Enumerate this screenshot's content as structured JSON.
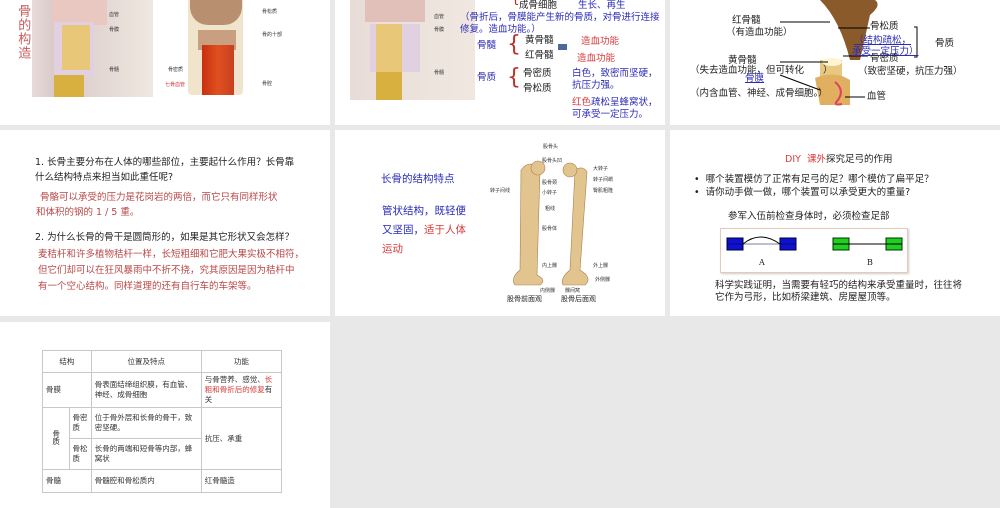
{
  "slides": {
    "s1": {
      "title": "骨的构造",
      "img1_labels": [
        "血管",
        "骨膜",
        "骨髓"
      ],
      "img2_labels": [
        "骨松质",
        "骨的十部",
        "骨密质",
        "七骨血管",
        "骨腔"
      ]
    },
    "s2": {
      "img_labels": [
        "血管",
        "骨膜",
        "骨髓"
      ],
      "osteoblast": "成骨细胞",
      "osteoblast_fn": "生长、再生",
      "note1": "（骨折后，骨膜能产生新的骨质，对骨进行连接",
      "note2": "修复。造血功能。）",
      "marrow": "骨髓",
      "yellow_marrow": "黄骨髓",
      "red_marrow": "红骨髓",
      "fn1": "造血功能",
      "fn2": "造血功能",
      "bone_substance": "骨质",
      "compact": "骨密质",
      "spongy": "骨松质",
      "compact_desc1": "白色，致密而坚硬，",
      "compact_desc2": "抗压力强。",
      "spongy_desc_red": "红色",
      "spongy_desc1": "疏松呈蜂窝状，",
      "spongy_desc2": "可承受一定压力。"
    },
    "s3": {
      "red_marrow": "红骨髓",
      "red_marrow_fn": "（有造血功能）",
      "spongy": "骨松质",
      "spongy_desc1": "（结构疏松，",
      "spongy_desc2": "承受一定压力）",
      "bone_substance": "骨质",
      "yellow_marrow": "黄骨髓",
      "yellow_marrow_fn": "（失去造血功能，但可转化　　）",
      "periosteum": "骨膜",
      "compact": "骨密质",
      "compact_desc": "（致密坚硬，抗压力强）",
      "periosteum_desc": "（内含血管、神经、成骨细胞。）",
      "vessel": "血管"
    },
    "s4": {
      "q1a": "1. 长骨主要分布在人体的哪些部位，主要起什么作用？长骨靠",
      "q1b": "什么结构特点来担当如此重任呢?",
      "a1a": "骨骼可以承受的压力是花岗岩的两倍，而它只有同样形状",
      "a1b": "和体积的钢的 1 / 5 重。",
      "q2": "2. 为什么长骨的骨干是圆筒形的，如果是其它形状又会怎样？",
      "a2a": "麦秸杆和许多植物秸杆一样，长短粗细和它肥大果实极不相符，",
      "a2b": "但它们却可以在狂风暴雨中不折不挠，究其原因是因为秸杆中",
      "a2c": "有一个空心结构。同样道理的还有自行车的车架等。"
    },
    "s5": {
      "title": "长骨的结构特点",
      "text1": "管状结构，既轻便",
      "text2a": "又坚固，",
      "text2b": "适于人体",
      "text3": "运动",
      "labels": [
        "股骨头",
        "股骨头凹",
        "股骨颈",
        "转子间线",
        "小转子",
        "大转子",
        "转子间嵴",
        "臀肌粗隆",
        "粗线",
        "股骨体",
        "内上髁",
        "外上髁",
        "外侧髁",
        "内侧髁",
        "髁间窝"
      ],
      "caption_front": "股骨前面观",
      "caption_back": "股骨后面观"
    },
    "s6": {
      "title_red": "DIY  课外",
      "title_rest": "探究足弓的作用",
      "bullets": [
        "哪个装置模仿了正常有足弓的足？哪个模仿了扁平足？",
        "请你动手做一做，哪个装置可以承受更大的重量?"
      ],
      "subtitle": "参军入伍前检查身体时，必须检查足部",
      "label_a": "A",
      "label_b": "B",
      "summary1": "科学实践证明，当需要有轻巧的结构来承受重量时，往往将",
      "summary2": "它作为弓形，比如桥梁建筑、房屋屋顶等。",
      "colors": {
        "a": "#1010d0",
        "b": "#20d020"
      }
    },
    "s7": {
      "headers": [
        "结构",
        "位置及特点",
        "功能"
      ],
      "periosteum": "骨膜",
      "periosteum_pos": "骨表面结缔组织膜，有血管、神经、成骨细胞",
      "periosteum_fn1": "与骨营养、感觉、",
      "periosteum_fn_red": "长粗和骨折后的修复",
      "periosteum_fn2": "有关",
      "bone_substance": "骨质",
      "compact": "骨密质",
      "compact_pos": "位于骨外层和长骨的骨干，致密坚硬。",
      "spongy": "骨松质",
      "spongy_pos": "长骨的两端和短骨等内部，蜂窝状",
      "substance_fn": "抗压、承重",
      "marrow": "骨髓",
      "marrow_pos": "骨髓腔和骨松质内",
      "marrow_fn": "红骨髓造"
    }
  }
}
